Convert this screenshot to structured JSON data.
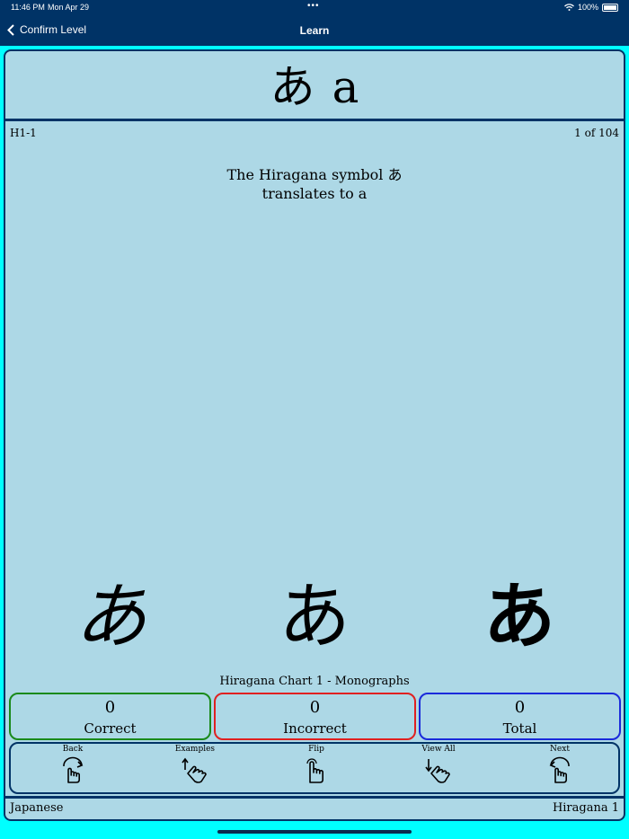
{
  "status_bar": {
    "time": "11:46 PM",
    "date": "Mon Apr 29",
    "dots": "•••",
    "battery": "100%"
  },
  "nav": {
    "back_label": "Confirm Level",
    "title": "Learn"
  },
  "card": {
    "title_symbol": "あ",
    "title_romaji": "a",
    "code": "H1-1",
    "position": "1 of 104",
    "description_line1": "The Hiragana symbol あ",
    "description_line2": "translates to a",
    "glyph_examples": [
      "あ",
      "あ",
      "あ"
    ],
    "chart_name": "Hiragana Chart 1 - Monographs"
  },
  "scores": {
    "correct": {
      "value": "0",
      "label": "Correct",
      "color": "#1a8a1a"
    },
    "incorrect": {
      "value": "0",
      "label": "Incorrect",
      "color": "#e02020"
    },
    "total": {
      "value": "0",
      "label": "Total",
      "color": "#1a2adb"
    }
  },
  "controls": [
    {
      "label": "Back",
      "icon": "swipe-back-icon"
    },
    {
      "label": "Examples",
      "icon": "swipe-up-icon"
    },
    {
      "label": "Flip",
      "icon": "tap-icon"
    },
    {
      "label": "View All",
      "icon": "swipe-down-icon"
    },
    {
      "label": "Next",
      "icon": "swipe-next-icon"
    }
  ],
  "footer": {
    "language": "Japanese",
    "level": "Hiragana 1"
  },
  "colors": {
    "nav_bg": "#003366",
    "page_bg": "#00ffff",
    "card_bg": "#add8e6"
  }
}
